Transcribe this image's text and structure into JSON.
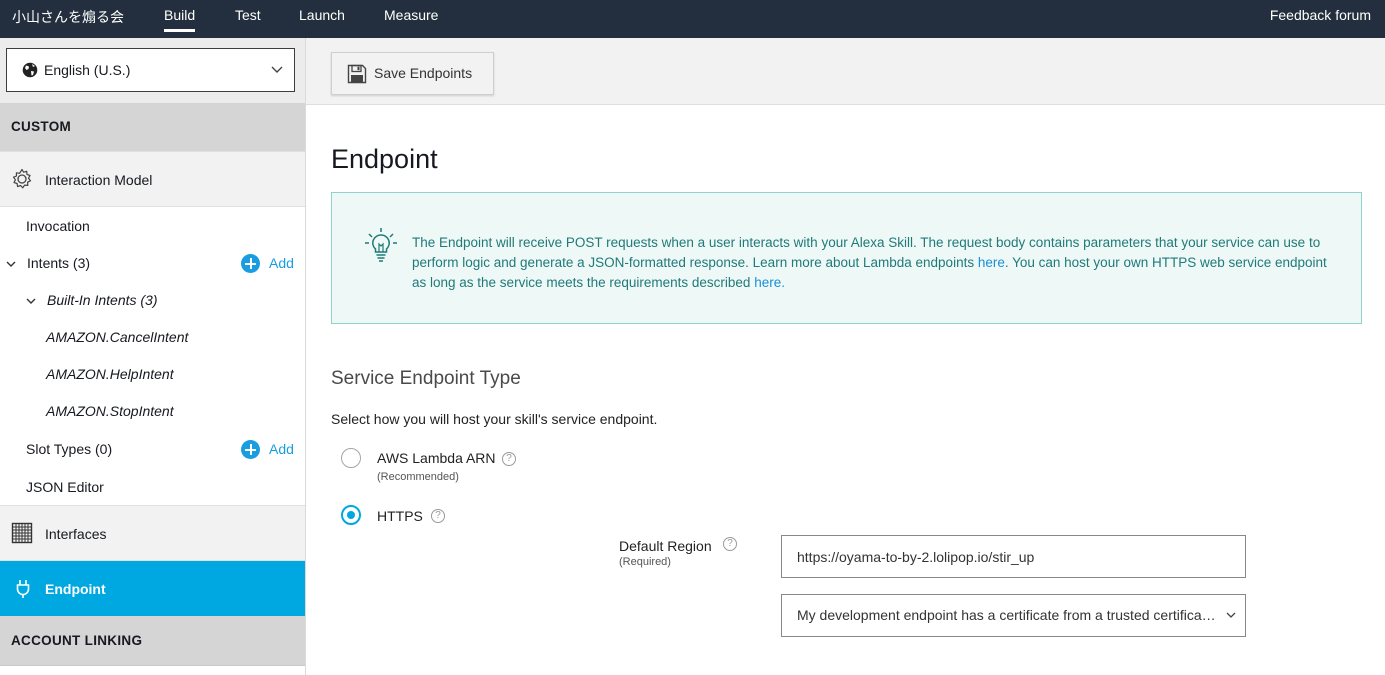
{
  "topbar": {
    "app_title": "小山さんを煽る会",
    "tabs": [
      {
        "label": "Build",
        "active": true
      },
      {
        "label": "Test",
        "active": false
      },
      {
        "label": "Launch",
        "active": false
      },
      {
        "label": "Measure",
        "active": false
      }
    ],
    "feedback": "Feedback forum"
  },
  "sidebar": {
    "language": "English (U.S.)",
    "custom_header": "CUSTOM",
    "interaction_model": "Interaction Model",
    "invocation": "Invocation",
    "intents": "Intents (3)",
    "add_label": "Add",
    "builtin_intents": "Built-In Intents (3)",
    "intent_items": [
      "AMAZON.CancelIntent",
      "AMAZON.HelpIntent",
      "AMAZON.StopIntent"
    ],
    "slot_types": "Slot Types (0)",
    "json_editor": "JSON Editor",
    "interfaces": "Interfaces",
    "endpoint": "Endpoint",
    "account_linking_header": "ACCOUNT LINKING"
  },
  "toolbar": {
    "save_label": "Save Endpoints"
  },
  "main": {
    "title": "Endpoint",
    "info": {
      "part1": "The Endpoint will receive POST requests when a user interacts with your Alexa Skill. The request body contains parameters that your service can use to perform logic and generate a JSON-formatted response. Learn more about Lambda endpoints ",
      "link1": "here",
      "part2": ". You can host your own HTTPS web service endpoint as long as the service meets the requirements described ",
      "link2": "here."
    },
    "service_type_heading": "Service Endpoint Type",
    "service_type_desc": "Select how you will host your skill's service endpoint.",
    "options": [
      {
        "label": "AWS Lambda ARN",
        "sub": "(Recommended)",
        "selected": false
      },
      {
        "label": "HTTPS",
        "sub": "",
        "selected": true
      }
    ],
    "default_region_label": "Default Region",
    "default_region_sub": "(Required)",
    "default_region_value": "https://oyama-to-by-2.lolipop.io/stir_up",
    "cert_select_value": "My development endpoint has a certificate from a trusted certificate authority"
  },
  "colors": {
    "topbar_bg": "#232f3e",
    "accent": "#00a8e1",
    "link": "#1a9de0",
    "info_bg": "#eef8f7",
    "info_text": "#1f7a78"
  },
  "icons": [
    "globe-icon",
    "chevron-down-icon",
    "gear-icon",
    "plus-icon",
    "grid-icon",
    "plug-icon",
    "save-disk-icon",
    "lightbulb-icon",
    "help-icon"
  ]
}
